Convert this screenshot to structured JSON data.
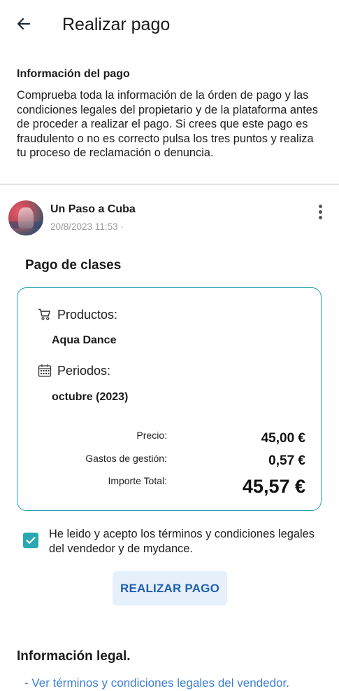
{
  "header": {
    "title": "Realizar pago"
  },
  "info": {
    "heading": "Información del pago",
    "body": "Comprueba toda la información de la órden de pago y las condiciones legales del propietario y de la plataforma antes de proceder a realizar el pago. Si crees que este pago es fraudulento o no es correcto pulsa los tres puntos y realiza tu proceso de reclamación o denuncia."
  },
  "post": {
    "name": "Un Paso a Cuba",
    "date": "20/8/2023 11:53 ·"
  },
  "order": {
    "title": "Pago de clases",
    "products_label": "Productos:",
    "products_value": "Aqua Dance",
    "periods_label": "Periodos:",
    "periods_value": "octubre (2023)",
    "price_label": "Precio:",
    "price_value": "45,00 €",
    "fees_label": "Gastos de gestión:",
    "fees_value": "0,57 €",
    "total_label": "Importe Total:",
    "total_value": "45,57 €"
  },
  "terms": {
    "checked": true,
    "text": "He leido y acepto los términos y condiciones legales del vendedor y de mydance."
  },
  "actions": {
    "pay_label": "REALIZAR PAGO"
  },
  "legal": {
    "heading": "Información legal.",
    "link_seller": "- Ver términos y condiciones legales del vendedor."
  },
  "colors": {
    "accent": "#1f9fae",
    "checkbox": "#2aa8b0",
    "button_bg": "#e6f0fb",
    "button_text": "#1f5fb0",
    "link": "#3d7fd6"
  }
}
